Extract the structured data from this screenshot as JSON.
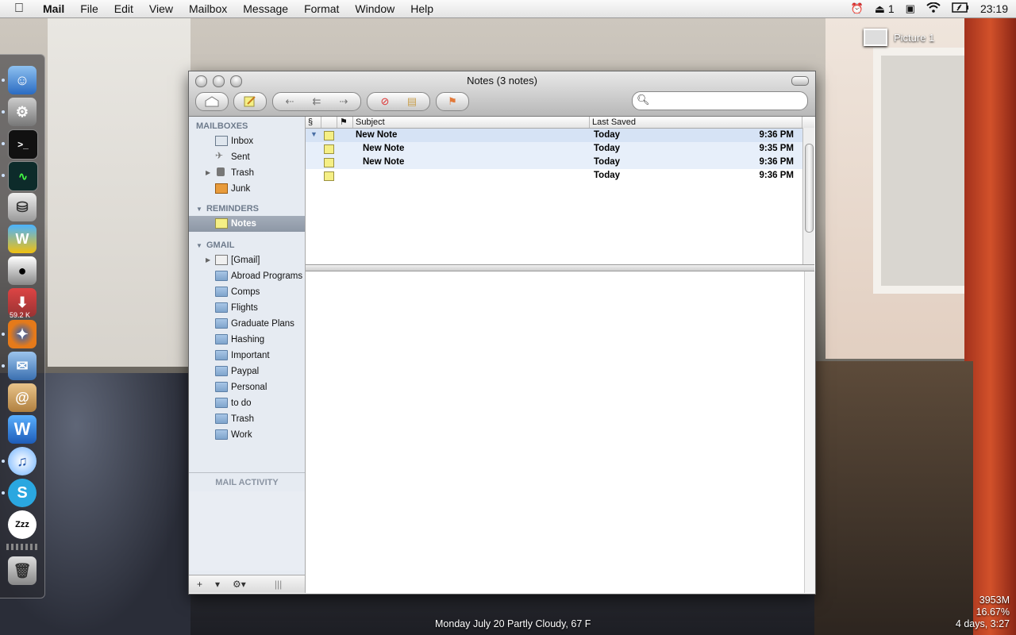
{
  "menubar": {
    "app": "Mail",
    "items": [
      "File",
      "Edit",
      "View",
      "Mailbox",
      "Message",
      "Format",
      "Window",
      "Help"
    ],
    "status_count": "1",
    "clock": "23:19"
  },
  "desktop": {
    "icon_label": "Picture 1"
  },
  "dock": {
    "badge": "59.2 K"
  },
  "window": {
    "title": "Notes (3 notes)",
    "toolbar": [
      "get-mail",
      "new-note",
      "reply",
      "reply-all",
      "forward",
      "delete",
      "junk",
      "flag"
    ],
    "search_placeholder": ""
  },
  "sidebar": {
    "mailboxes_header": "MAILBOXES",
    "mailboxes": [
      "Inbox",
      "Sent",
      "Trash",
      "Junk"
    ],
    "reminders_header": "REMINDERS",
    "reminders": [
      "Notes"
    ],
    "gmail_header": "GMAIL",
    "gmail": [
      "[Gmail]",
      "Abroad Programs",
      "Comps",
      "Flights",
      "Graduate Plans",
      "Hashing",
      "Important",
      "Paypal",
      "Personal",
      "to do",
      "Trash",
      "Work"
    ],
    "activity_header": "MAIL ACTIVITY",
    "bottom": {
      "add": "+",
      "gear": "⚙▾",
      "grip": "|||"
    }
  },
  "list": {
    "columns": {
      "subject": "Subject",
      "last_saved": "Last Saved"
    },
    "rows": [
      {
        "subject": "New Note",
        "date": "Today",
        "time": "9:36 PM"
      },
      {
        "subject": "New Note",
        "date": "Today",
        "time": "9:35 PM"
      },
      {
        "subject": "New Note",
        "date": "Today",
        "time": "9:36 PM"
      },
      {
        "subject": "",
        "date": "Today",
        "time": "9:36 PM"
      }
    ]
  },
  "desktop_status": {
    "weather": "Monday  July 20  Partly Cloudy, 67 F",
    "memory": "3953M",
    "cpu": "16.67%",
    "uptime": "4 days, 3:27"
  }
}
